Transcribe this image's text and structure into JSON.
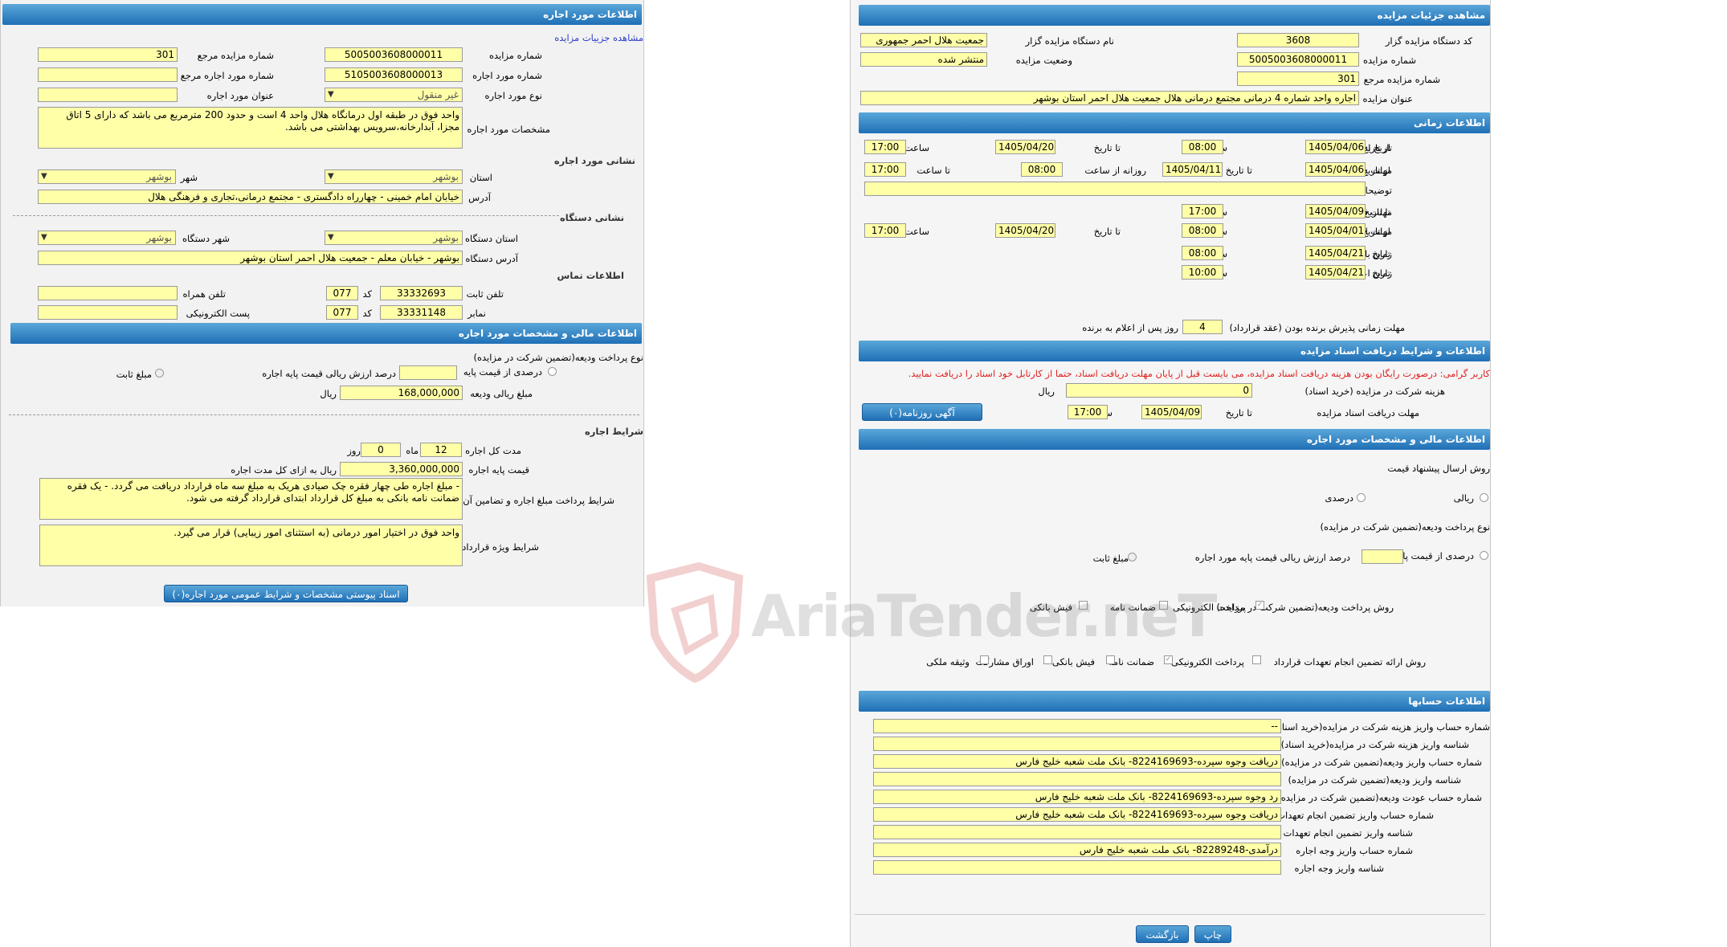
{
  "left": {
    "header_lease": "اطلاعات مورد اجاره",
    "details_link": "مشاهده جزییات مزایده",
    "auction_number_label": "شماره مزایده",
    "auction_number": "5005003608000011",
    "ref_number_label": "شماره مزایده مرجع",
    "ref_number": "301",
    "lease_number_label": "شماره مورد اجاره",
    "lease_number": "5105003608000013",
    "lease_ref_label": "شماره مورد اجاره مرجع",
    "lease_ref": "",
    "lease_type_label": "نوع مورد اجاره",
    "lease_type": "غیر منقول",
    "lease_title_label": "عنوان مورد اجاره",
    "lease_title": "",
    "specs_label": "مشخصات مورد اجاره",
    "specs": "واحد فوق در طبقه اول درمانگاه هلال واحد 4 است و حدود 200 مترمربع می باشد که دارای 5 اتاق مجزا، آبدارخانه،سرویس بهداشتی می باشد.",
    "address_section": "نشانی مورد اجاره",
    "province_label": "استان",
    "province": "بوشهر",
    "city_label": "شهر",
    "city": "بوشهر",
    "address_label": "آدرس",
    "address": "خیابان امام خمینی - چهارراه دادگستری - مجتمع درمانی،تجاری و فرهنگی هلال",
    "agency_section": "نشانی دستگاه",
    "agency_province_label": "استان دستگاه",
    "agency_province": "بوشهر",
    "agency_city_label": "شهر دستگاه",
    "agency_city": "بوشهر",
    "agency_address_label": "آدرس دستگاه",
    "agency_address": "بوشهر - خیابان معلم - جمعیت هلال احمر استان بوشهر",
    "contact_section": "اطلاعات تماس",
    "phone_label": "تلفن ثابت",
    "phone": "33332693",
    "code_label": "کد",
    "phone_code": "077",
    "mobile_label": "تلفن همراه",
    "mobile": "",
    "fax_label": "نمابر",
    "fax": "33331148",
    "fax_code": "077",
    "email_label": "پست الکترونیکی",
    "email": "",
    "header_financial": "اطلاعات مالی و مشخصات مورد اجاره",
    "deposit_method_label": "نوع پرداخت ودیعه(تضمین شرکت در مزایده)",
    "percent_base_label": "درصدی از قیمت پایه",
    "percent_value_label": "درصد ارزش ریالی قیمت پایه اجاره",
    "percent_value": "",
    "fixed_amount_label": "مبلغ ثابت",
    "deposit_amount_label": "مبلغ ریالی ودیعه",
    "deposit_amount": "168,000,000",
    "rial_label": "ریال",
    "terms_section": "شرایط اجاره",
    "duration_label": "مدت کل اجاره",
    "duration_months": "12",
    "month_label": "ماه",
    "duration_days": "0",
    "day_label": "روز",
    "base_price_label": "قیمت پایه اجاره",
    "base_price": "3,360,000,000",
    "base_price_unit": "ریال به ازای کل مدت اجاره",
    "payment_terms_label": "شرایط پرداخت مبلغ اجاره و تضامین آن",
    "payment_terms": "- مبلغ اجاره طی چهار فقره چک صیادی هریک به مبلغ سه ماه قرارداد دریافت می گردد. - یک فقره ضمانت نامه بانکی به مبلغ کل قرارداد ابتدای قرارداد گرفته می شود.",
    "special_terms_label": "شرایط ویژه قرارداد",
    "special_terms": "واحد فوق در اختیار امور درمانی (به استثنای امور زیبایی) قرار می گیرد.",
    "attachments_button": "اسناد پیوستی مشخصات و شرایط عمومی مورد اجاره(۰)"
  },
  "right": {
    "header_details": "مشاهده جزئیات مزایده",
    "agency_code_label": "کد دستگاه مزایده گزار",
    "agency_code": "3608",
    "agency_name_label": "نام دستگاه مزایده گزار",
    "agency_name": "جمعیت هلال احمر جمهوری",
    "auction_number_label": "شماره مزایده",
    "auction_number": "5005003608000011",
    "status_label": "وضعیت مزایده",
    "status": "منتشر شده",
    "ref_number_label": "شماره مزایده مرجع",
    "ref_number": "301",
    "title_label": "عنوان مزایده",
    "title": "اجاره واحد شماره 4 درمانی مجتمع درمانی هلال جمعیت هلال احمر استان بوشهر",
    "header_time": "اطلاعات زمانی",
    "publish_label": "تاریخ انتشار",
    "from_date_label": "از تاریخ",
    "to_date_label": "تا تاریخ",
    "time_label": "ساعت",
    "publish_from": "1405/04/06",
    "publish_from_time": "08:00",
    "publish_to": "1405/04/20",
    "publish_to_time": "17:00",
    "visit_label": "مهلت بازدید",
    "visit_from": "1405/04/06",
    "visit_to": "1405/04/11",
    "daily_from_label": "روزانه از ساعت",
    "daily_from": "08:00",
    "to_time_label": "تا ساعت",
    "daily_to": "17:00",
    "desc_label": "توضیحات",
    "desc": "",
    "docs_deadline_label": "مهلت دریافت اسناد",
    "docs_to": "1405/04/09",
    "docs_time": "17:00",
    "offer_label": "مهلت ارائه پیشنهاد",
    "offer_from": "1405/04/01",
    "offer_from_time": "08:00",
    "offer_to": "1405/04/20",
    "offer_to_time": "17:00",
    "opening_label": "زمان بازگشایی",
    "date_label": "تاریخ",
    "opening_date": "1405/04/21",
    "opening_time": "08:00",
    "winner_label": "زمان اعلام برنده",
    "winner_date": "1405/04/21",
    "winner_time": "10:00",
    "acceptance_label": "مهلت زمانی پذیرش برنده بودن (عقد قرارداد)",
    "acceptance_days": "4",
    "acceptance_suffix": "روز پس از اعلام به برنده",
    "header_docs": "اطلاعات و شرایط دریافت اسناد مزایده",
    "warning": "کاربر گرامی: درصورت رایگان بودن هزینه دریافت اسناد مزایده، می بایست قبل از پایان مهلت دریافت اسناد، حتما از کارتابل خود اسناد را دریافت نمایید.",
    "doc_fee_label": "هزینه شرکت در مزایده (خرید اسناد)",
    "doc_fee": "0",
    "rial_label": "ریال",
    "doc_deadline_label": "مهلت دریافت اسناد مزایده",
    "doc_deadline_date": "1405/04/09",
    "doc_deadline_time": "17:00",
    "newspaper_button": "آگهی روزنامه(۰)",
    "header_financial": "اطلاعات مالی و مشخصات مورد اجاره",
    "price_method_label": "روش ارسال پیشنهاد قیمت",
    "rial_option": "ریالی",
    "percent_option": "درصدی",
    "deposit_type_label": "نوع پرداخت ودیعه(تضمین شرکت در مزایده)",
    "percent_base_label": "درصدی از قیمت پایه",
    "percent_value_label": "درصد ارزش ریالی قیمت پایه مورد اجاره",
    "fixed_amount_label": "مبلغ ثابت",
    "deposit_method_label": "روش پرداخت ودیعه(تضمین شرکت در مزایده)",
    "electronic": "پرداخت الکترونیکی",
    "guarantee": "ضمانت نامه",
    "bank_receipt": "فیش بانکی",
    "guarantee_method_label": "روش ارائه تضمین انجام تعهدات قرارداد",
    "partnership_bonds": "اوراق مشارکت",
    "property_collateral": "وثیقه ملکی",
    "header_accounts": "اطلاعات حسابها",
    "acc_fee_label": "شماره حساب واریز هزینه شرکت در مزایده(خرید اسناد)",
    "acc_fee": "--",
    "acc_fee_id_label": "شناسه واریز هزینه شرکت در مزایده(خرید اسناد)",
    "acc_fee_id": "",
    "acc_deposit_label": "شماره حساب واریز ودیعه(تضمین شرکت در مزایده)",
    "acc_deposit": "دریافت وجوه سپرده-8224169693- بانک ملت شعبه خلیج فارس",
    "acc_deposit_id_label": "شناسه واریز ودیعه(تضمین شرکت در مزایده)",
    "acc_deposit_id": "",
    "acc_refund_label": "شماره حساب عودت ودیعه(تضمین شرکت در مزایده)",
    "acc_refund": "رد وجوه سپرده-8224169693- بانک ملت شعبه خلیج فارس",
    "acc_commit_label": "شماره حساب واریز تضمین انجام تعهدات",
    "acc_commit": "دریافت وجوه سپرده-8224169693- بانک ملت شعبه خلیج فارس",
    "acc_commit_id_label": "شناسه واریز تضمین انجام تعهدات",
    "acc_commit_id": "",
    "acc_lease_label": "شماره حساب واریز وجه اجاره",
    "acc_lease": "درآمدی-82289248- بانک ملت شعبه خلیج فارس",
    "acc_lease_id_label": "شناسه واریز وجه اجاره",
    "acc_lease_id": "",
    "print_button": "چاپ",
    "back_button": "بازگشت"
  },
  "watermark": "AriaTender.neT",
  "colors": {
    "header": "#2b7fc4",
    "field": "#ffffa8",
    "warning": "#e02020",
    "link": "#2b3cc8"
  }
}
